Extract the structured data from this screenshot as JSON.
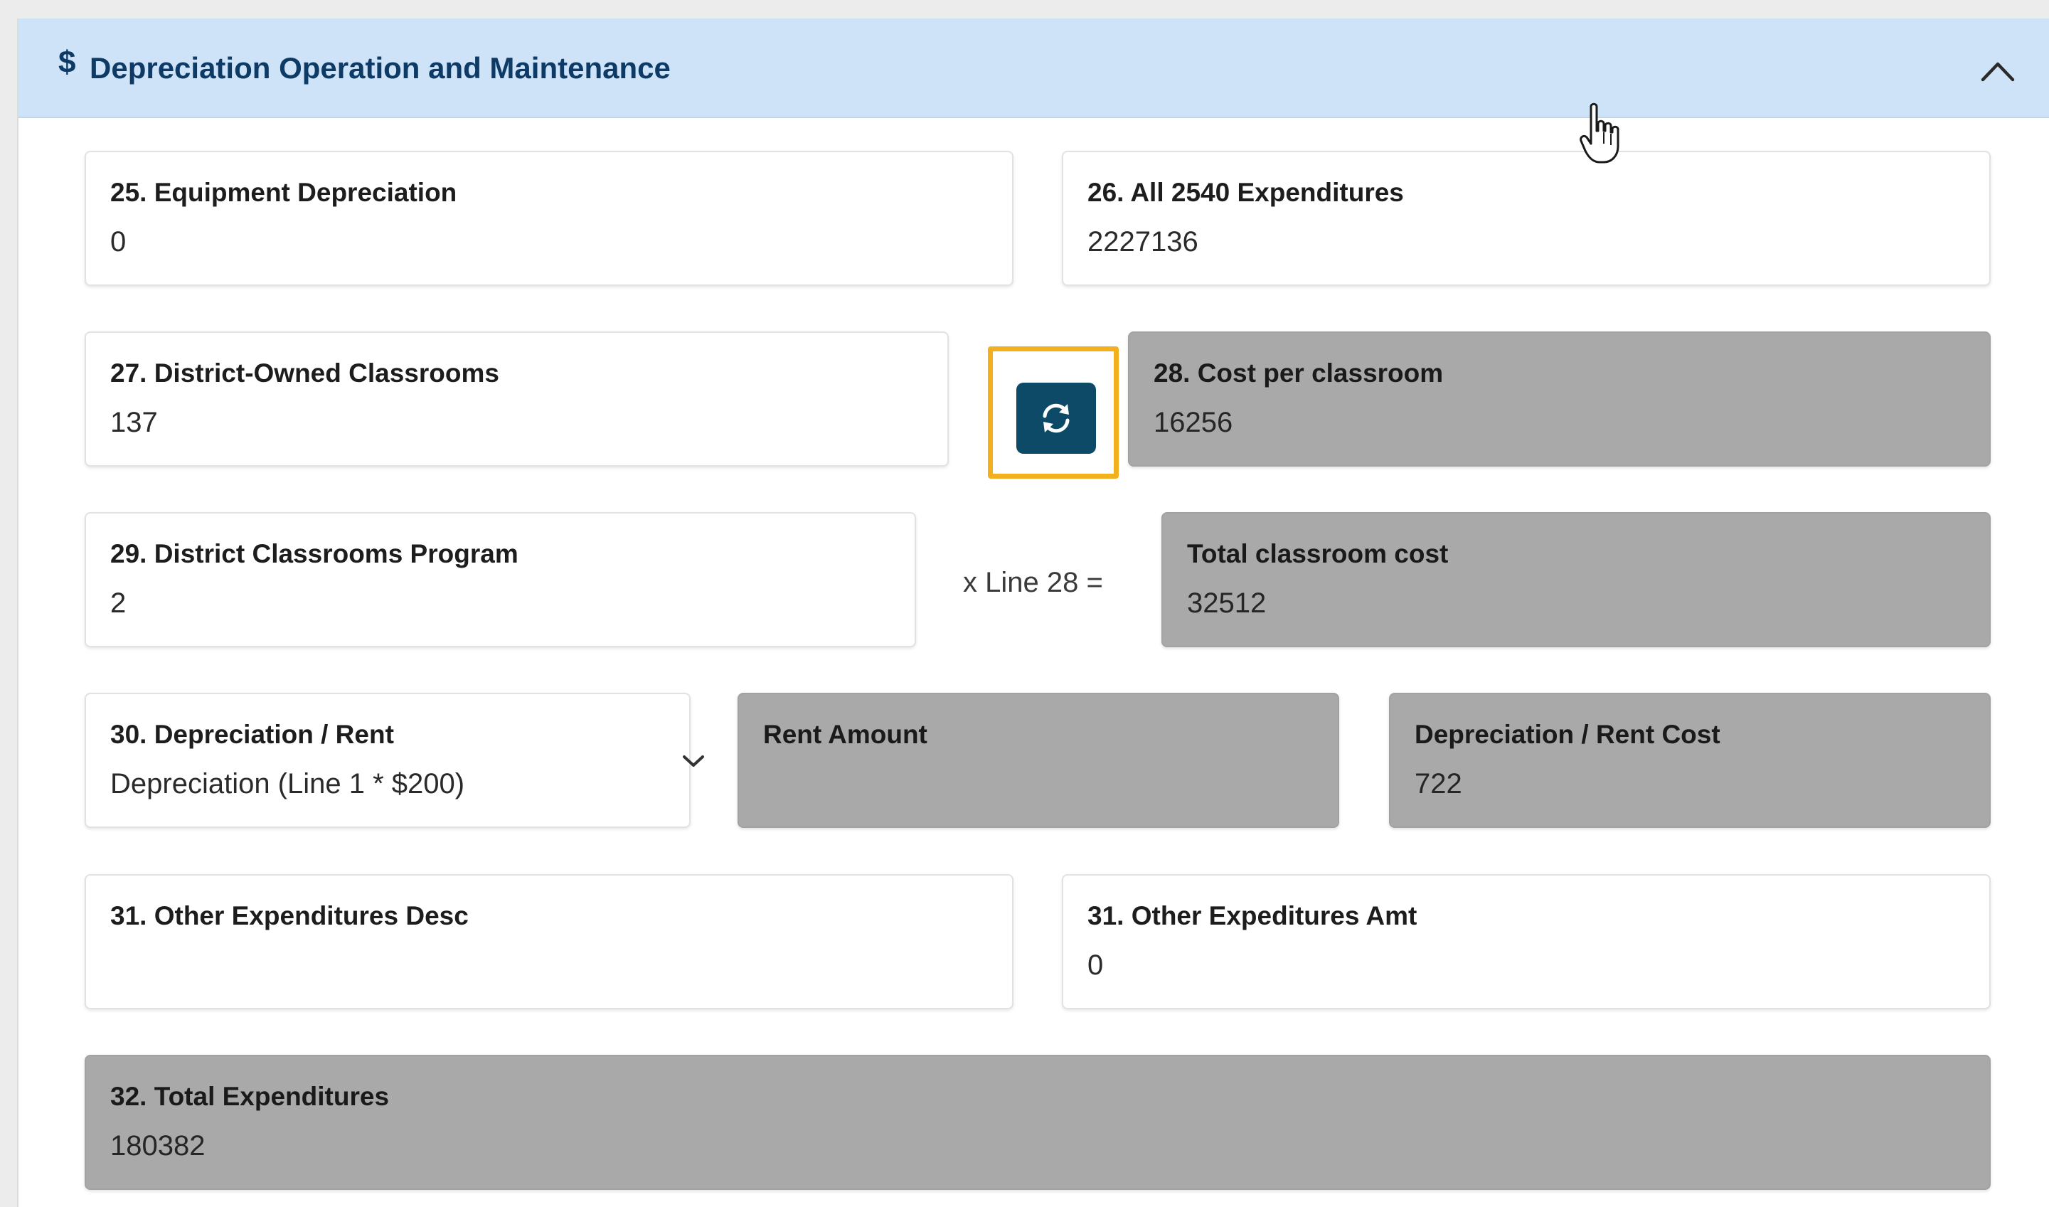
{
  "section": {
    "icon": "$",
    "title": "Depreciation Operation and Maintenance",
    "collapse_icon": "chevron-up-icon"
  },
  "fields": {
    "f25": {
      "label": "25. Equipment Depreciation",
      "value": "0"
    },
    "f26": {
      "label": "26. All 2540 Expenditures",
      "value": "2227136"
    },
    "f27": {
      "label": "27. District-Owned Classrooms",
      "value": "137"
    },
    "f28": {
      "label": "28. Cost per classroom",
      "value": "16256"
    },
    "f29": {
      "label": "29. District Classrooms Program",
      "value": "2"
    },
    "total_classroom": {
      "label": "Total classroom cost",
      "value": "32512"
    },
    "f30": {
      "label": "30. Depreciation / Rent",
      "value": "Depreciation (Line 1 * $200)"
    },
    "rent_amount": {
      "label": "Rent Amount",
      "value": ""
    },
    "dep_rent_cost": {
      "label": "Depreciation / Rent Cost",
      "value": "722"
    },
    "f31_desc": {
      "label": "31. Other Expenditures Desc",
      "value": ""
    },
    "f31_amt": {
      "label": "31. Other Expeditures Amt",
      "value": "0"
    },
    "f32": {
      "label": "32. Total Expenditures",
      "value": "180382"
    }
  },
  "multiplier_text": "x Line 28 =",
  "refresh_button": {
    "icon": "refresh-icon"
  },
  "colors": {
    "header_bg": "#cfe3f8",
    "title": "#0e3b66",
    "readonly_bg": "#a9a9a9",
    "button_bg": "#0c4a68",
    "highlight_border": "#f2b01e"
  }
}
